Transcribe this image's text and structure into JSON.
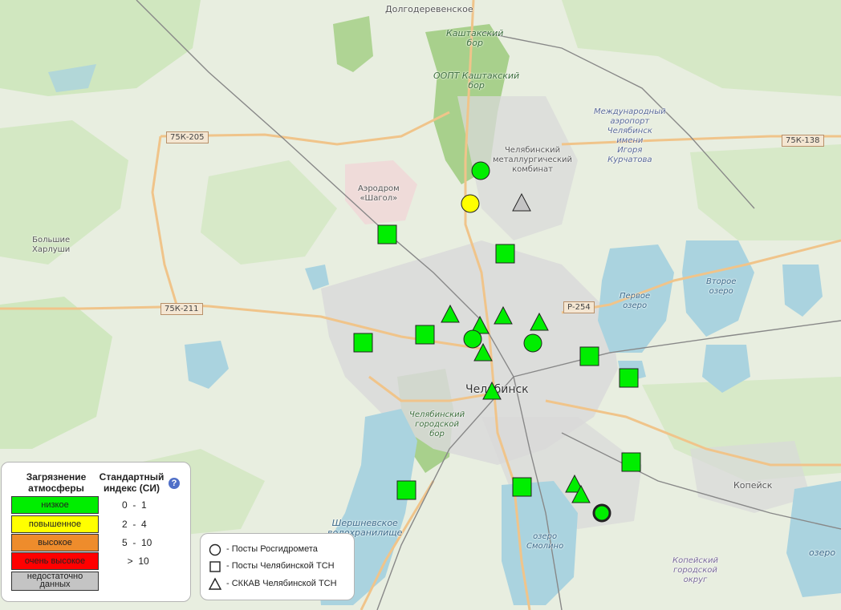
{
  "map": {
    "places": [
      {
        "id": "dolgoderevenskoe",
        "text": "Долгодеревенское"
      },
      {
        "id": "kashtak-bor",
        "text": "Каштакский\nбор"
      },
      {
        "id": "oopt",
        "text": "ООПТ Каштакский\nбор"
      },
      {
        "id": "airport",
        "text": "Международный\nаэропорт\nЧелябинск\nимени\nИгоря\nКурчатова"
      },
      {
        "id": "mk",
        "text": "Челябинский\nметаллургический\nкомбинат"
      },
      {
        "id": "shagol",
        "text": "Аэродром\n«Шагол»"
      },
      {
        "id": "harlushi",
        "text": "Большие\nХарлуши"
      },
      {
        "id": "pervoe",
        "text": "Первое\nозеро"
      },
      {
        "id": "vtoroe",
        "text": "Второе\nозеро"
      },
      {
        "id": "chelyabinsk",
        "text": "Челябинск"
      },
      {
        "id": "gor-bor",
        "text": "Челябинский\nгородской\nбор"
      },
      {
        "id": "shershni",
        "text": "Шершневское\nводохранилище"
      },
      {
        "id": "smolino",
        "text": "озеро\nСмолино"
      },
      {
        "id": "kopeysk",
        "text": "Копейск"
      },
      {
        "id": "kop-okrug",
        "text": "Копейский\nгородской\nокруг"
      },
      {
        "id": "ozero-right",
        "text": "озеро"
      }
    ],
    "road_labels": [
      "75К-205",
      "75К-138",
      "75К-211",
      "Р-254"
    ],
    "markers": [
      {
        "shape": "circle",
        "level": "low"
      },
      {
        "shape": "circle",
        "level": "elevated"
      },
      {
        "shape": "triangle",
        "level": "nodata"
      },
      {
        "shape": "square",
        "level": "low"
      },
      {
        "shape": "square",
        "level": "low"
      },
      {
        "shape": "triangle",
        "level": "low"
      },
      {
        "shape": "triangle",
        "level": "low"
      },
      {
        "shape": "triangle",
        "level": "low"
      },
      {
        "shape": "triangle",
        "level": "low"
      },
      {
        "shape": "circle",
        "level": "low"
      },
      {
        "shape": "circle",
        "level": "low"
      },
      {
        "shape": "triangle",
        "level": "low"
      },
      {
        "shape": "square",
        "level": "low"
      },
      {
        "shape": "square",
        "level": "low"
      },
      {
        "shape": "square",
        "level": "low"
      },
      {
        "shape": "square",
        "level": "low"
      },
      {
        "shape": "triangle",
        "level": "low"
      },
      {
        "shape": "square",
        "level": "low"
      },
      {
        "shape": "square",
        "level": "low"
      },
      {
        "shape": "square",
        "level": "low"
      },
      {
        "shape": "triangle",
        "level": "low"
      },
      {
        "shape": "triangle",
        "level": "low"
      },
      {
        "shape": "circle",
        "level": "low",
        "highlighted": true
      }
    ]
  },
  "colors": {
    "low": "#00ee00",
    "elevated": "#ffff00",
    "high": "#ee8c2c",
    "very_high": "#ff0000",
    "nodata": "#c4c4c4",
    "water": "#aad3df",
    "forest": "#c8e6b4",
    "urban": "#dcdcdc",
    "road": "#f5c98a"
  },
  "legend_pollution": {
    "title": "Загрязнение атмосферы",
    "index_title": "Стандартный индекс (СИ)",
    "help_icon": "?",
    "levels": [
      {
        "label": "низкое",
        "range": "0  -  1",
        "color": "#00ee00"
      },
      {
        "label": "повышенное",
        "range": "2  -  4",
        "color": "#ffff00"
      },
      {
        "label": "высокое",
        "range": "5  -  10",
        "color": "#ee8c2c"
      },
      {
        "label": "очень высокое",
        "range": "     >  10",
        "color": "#ff0000"
      },
      {
        "label": "недостаточно данных",
        "range": "",
        "color": "#c4c4c4"
      }
    ]
  },
  "legend_posts": {
    "items": [
      {
        "icon": "circle-icon",
        "label": "- Посты Росгидромета"
      },
      {
        "icon": "square-icon",
        "label": "- Посты Челябинской ТСН"
      },
      {
        "icon": "triangle-icon",
        "label": "- СККАВ Челябинской ТСН"
      }
    ]
  }
}
